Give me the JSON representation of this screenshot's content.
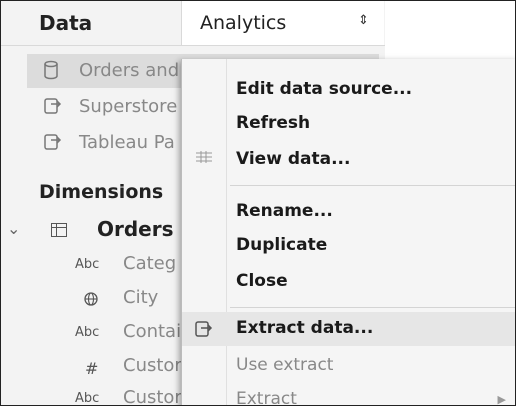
{
  "header": {
    "data_tab": "Data",
    "analytics_tab": "Analytics",
    "analytics_sort_glyph": "⇕"
  },
  "data_sources": [
    {
      "label": "Orders and",
      "icon": "database-cylinder-icon",
      "selected": true
    },
    {
      "label": "Superstore",
      "icon": "extract-datasource-icon",
      "selected": false
    },
    {
      "label": "Tableau Pa",
      "icon": "extract-datasource-icon",
      "selected": false
    }
  ],
  "dimensions": {
    "title": "Dimensions",
    "table_name": "Orders",
    "fields": [
      {
        "type": "Abc",
        "name": "Categ"
      },
      {
        "type": "globe",
        "name": "City"
      },
      {
        "type": "Abc",
        "name": "Contai"
      },
      {
        "type": "#",
        "name": "Custor"
      },
      {
        "type": "Abc",
        "name": "Custor"
      }
    ]
  },
  "context_menu": {
    "items": [
      {
        "label": "Edit data source...",
        "enabled": true
      },
      {
        "label": "Refresh",
        "enabled": true
      },
      {
        "label": "View data...",
        "enabled": true,
        "icon": "grid-view-icon"
      },
      {
        "label": "Rename...",
        "enabled": true
      },
      {
        "label": "Duplicate",
        "enabled": true
      },
      {
        "label": "Close",
        "enabled": true
      },
      {
        "label": "Extract data...",
        "enabled": true,
        "highlighted": true,
        "icon": "extract-icon"
      },
      {
        "label": "Use extract",
        "enabled": false
      },
      {
        "label": "Extract",
        "enabled": false,
        "submenu": true
      }
    ]
  },
  "colors": {
    "pane_bg": "#f3f3f3",
    "menu_bg": "#f5f5f5",
    "highlight": "#e6e6e6"
  }
}
